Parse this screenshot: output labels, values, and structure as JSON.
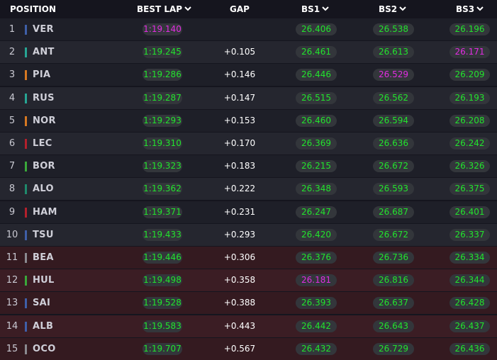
{
  "header": {
    "position": "POSITION",
    "best_lap": "BEST LAP",
    "gap": "GAP",
    "bs1": "BS1",
    "bs2": "BS2",
    "bs3": "BS3"
  },
  "colors": {
    "fastest": "#e22ce2",
    "personal": "#22e32d",
    "row_dark": "#1e1f28",
    "row_light": "#25262f",
    "row_elim_dark": "#341a20",
    "row_elim_light": "#3b1d24"
  },
  "rows": [
    {
      "pos": "1",
      "driver": "VER",
      "team_color": "#3f5fa8",
      "best_lap": "1:19.140",
      "best_lap_status": "purple",
      "gap": "",
      "bs1": "26.406",
      "bs1_status": "green",
      "bs2": "26.538",
      "bs2_status": "green",
      "bs3": "26.196",
      "bs3_status": "green"
    },
    {
      "pos": "2",
      "driver": "ANT",
      "team_color": "#27a594",
      "best_lap": "1:19.245",
      "best_lap_status": "green",
      "gap": "+0.105",
      "bs1": "26.461",
      "bs1_status": "green",
      "bs2": "26.613",
      "bs2_status": "green",
      "bs3": "26.171",
      "bs3_status": "purple"
    },
    {
      "pos": "3",
      "driver": "PIA",
      "team_color": "#d67822",
      "best_lap": "1:19.286",
      "best_lap_status": "green",
      "gap": "+0.146",
      "bs1": "26.446",
      "bs1_status": "green",
      "bs2": "26.529",
      "bs2_status": "purple",
      "bs3": "26.209",
      "bs3_status": "green"
    },
    {
      "pos": "4",
      "driver": "RUS",
      "team_color": "#27a594",
      "best_lap": "1:19.287",
      "best_lap_status": "green",
      "gap": "+0.147",
      "bs1": "26.515",
      "bs1_status": "green",
      "bs2": "26.562",
      "bs2_status": "green",
      "bs3": "26.193",
      "bs3_status": "green"
    },
    {
      "pos": "5",
      "driver": "NOR",
      "team_color": "#d67822",
      "best_lap": "1:19.293",
      "best_lap_status": "green",
      "gap": "+0.153",
      "bs1": "26.460",
      "bs1_status": "green",
      "bs2": "26.594",
      "bs2_status": "green",
      "bs3": "26.208",
      "bs3_status": "green"
    },
    {
      "pos": "6",
      "driver": "LEC",
      "team_color": "#b3202c",
      "best_lap": "1:19.310",
      "best_lap_status": "green",
      "gap": "+0.170",
      "bs1": "26.369",
      "bs1_status": "green",
      "bs2": "26.636",
      "bs2_status": "green",
      "bs3": "26.242",
      "bs3_status": "green"
    },
    {
      "pos": "7",
      "driver": "BOR",
      "team_color": "#3aa83a",
      "best_lap": "1:19.323",
      "best_lap_status": "green",
      "gap": "+0.183",
      "bs1": "26.215",
      "bs1_status": "green",
      "bs2": "26.672",
      "bs2_status": "green",
      "bs3": "26.326",
      "bs3_status": "green"
    },
    {
      "pos": "8",
      "driver": "ALO",
      "team_color": "#1f8a6c",
      "best_lap": "1:19.362",
      "best_lap_status": "green",
      "gap": "+0.222",
      "bs1": "26.348",
      "bs1_status": "green",
      "bs2": "26.593",
      "bs2_status": "green",
      "bs3": "26.375",
      "bs3_status": "green"
    },
    {
      "pos": "9",
      "driver": "HAM",
      "team_color": "#b3202c",
      "best_lap": "1:19.371",
      "best_lap_status": "green",
      "gap": "+0.231",
      "bs1": "26.247",
      "bs1_status": "green",
      "bs2": "26.687",
      "bs2_status": "green",
      "bs3": "26.401",
      "bs3_status": "green"
    },
    {
      "pos": "10",
      "driver": "TSU",
      "team_color": "#3f5fa8",
      "best_lap": "1:19.433",
      "best_lap_status": "green",
      "gap": "+0.293",
      "bs1": "26.420",
      "bs1_status": "green",
      "bs2": "26.672",
      "bs2_status": "green",
      "bs3": "26.337",
      "bs3_status": "green"
    },
    {
      "pos": "11",
      "driver": "BEA",
      "team_color": "#8a8a90",
      "best_lap": "1:19.446",
      "best_lap_status": "green",
      "gap": "+0.306",
      "bs1": "26.376",
      "bs1_status": "green",
      "bs2": "26.736",
      "bs2_status": "green",
      "bs3": "26.334",
      "bs3_status": "green"
    },
    {
      "pos": "12",
      "driver": "HUL",
      "team_color": "#3aa83a",
      "best_lap": "1:19.498",
      "best_lap_status": "green",
      "gap": "+0.358",
      "bs1": "26.181",
      "bs1_status": "purple",
      "bs2": "26.816",
      "bs2_status": "green",
      "bs3": "26.344",
      "bs3_status": "green"
    },
    {
      "pos": "13",
      "driver": "SAI",
      "team_color": "#3f5fa8",
      "best_lap": "1:19.528",
      "best_lap_status": "green",
      "gap": "+0.388",
      "bs1": "26.393",
      "bs1_status": "green",
      "bs2": "26.637",
      "bs2_status": "green",
      "bs3": "26.428",
      "bs3_status": "green"
    },
    {
      "pos": "14",
      "driver": "ALB",
      "team_color": "#3f5fa8",
      "best_lap": "1:19.583",
      "best_lap_status": "green",
      "gap": "+0.443",
      "bs1": "26.442",
      "bs1_status": "green",
      "bs2": "26.643",
      "bs2_status": "green",
      "bs3": "26.437",
      "bs3_status": "green"
    },
    {
      "pos": "15",
      "driver": "OCO",
      "team_color": "#8a8a90",
      "best_lap": "1:19.707",
      "best_lap_status": "green",
      "gap": "+0.567",
      "bs1": "26.432",
      "bs1_status": "green",
      "bs2": "26.729",
      "bs2_status": "green",
      "bs3": "26.436",
      "bs3_status": "green"
    }
  ]
}
